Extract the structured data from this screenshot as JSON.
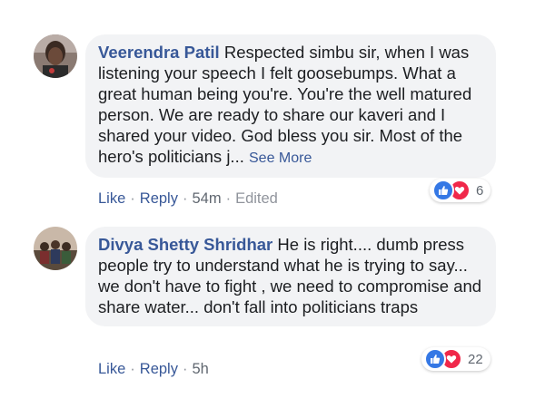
{
  "comments": [
    {
      "author": "Veerendra Patil",
      "text": "Respected simbu sir, when I was listening your speech I felt goosebumps. What a great human being you're. You're the well matured person. We are ready to share our kaveri and I shared your video. God bless you sir. Most of the hero's politicians j...",
      "see_more": "See More",
      "reaction_count": "6",
      "like": "Like",
      "reply": "Reply",
      "time": "54m",
      "edited": "Edited",
      "separator": "·"
    },
    {
      "author": "Divya Shetty Shridhar",
      "text": "He is right.... dumb press people try to understand what he is trying to say... we don't have to fight , we need to compromise and share water... don't fall into politicians traps",
      "reaction_count": "22",
      "like": "Like",
      "reply": "Reply",
      "time": "5h",
      "separator": "·"
    }
  ],
  "colors": {
    "link": "#385898",
    "bubble": "#f2f3f5",
    "like_reaction": "#3578e5",
    "love_reaction": "#f0284a",
    "meta": "#606770"
  },
  "icons": [
    "like-reaction-icon",
    "love-reaction-icon"
  ]
}
